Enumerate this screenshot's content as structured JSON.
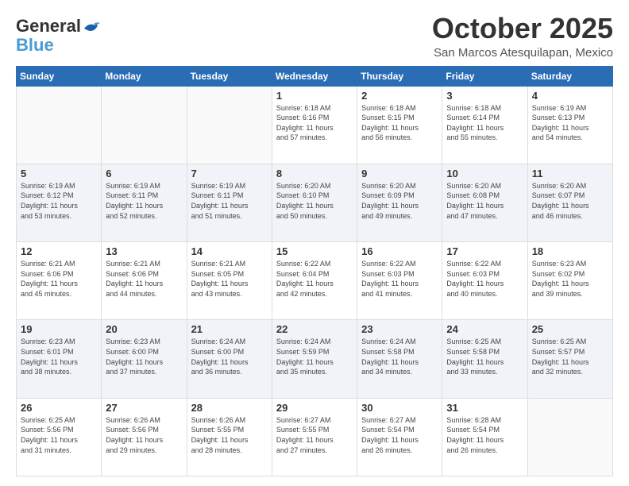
{
  "logo": {
    "general": "General",
    "blue": "Blue"
  },
  "header": {
    "month": "October 2025",
    "location": "San Marcos Atesquilapan, Mexico"
  },
  "weekdays": [
    "Sunday",
    "Monday",
    "Tuesday",
    "Wednesday",
    "Thursday",
    "Friday",
    "Saturday"
  ],
  "weeks": [
    {
      "shaded": false,
      "days": [
        {
          "date": "",
          "info": ""
        },
        {
          "date": "",
          "info": ""
        },
        {
          "date": "",
          "info": ""
        },
        {
          "date": "1",
          "info": "Sunrise: 6:18 AM\nSunset: 6:16 PM\nDaylight: 11 hours\nand 57 minutes."
        },
        {
          "date": "2",
          "info": "Sunrise: 6:18 AM\nSunset: 6:15 PM\nDaylight: 11 hours\nand 56 minutes."
        },
        {
          "date": "3",
          "info": "Sunrise: 6:18 AM\nSunset: 6:14 PM\nDaylight: 11 hours\nand 55 minutes."
        },
        {
          "date": "4",
          "info": "Sunrise: 6:19 AM\nSunset: 6:13 PM\nDaylight: 11 hours\nand 54 minutes."
        }
      ]
    },
    {
      "shaded": true,
      "days": [
        {
          "date": "5",
          "info": "Sunrise: 6:19 AM\nSunset: 6:12 PM\nDaylight: 11 hours\nand 53 minutes."
        },
        {
          "date": "6",
          "info": "Sunrise: 6:19 AM\nSunset: 6:11 PM\nDaylight: 11 hours\nand 52 minutes."
        },
        {
          "date": "7",
          "info": "Sunrise: 6:19 AM\nSunset: 6:11 PM\nDaylight: 11 hours\nand 51 minutes."
        },
        {
          "date": "8",
          "info": "Sunrise: 6:20 AM\nSunset: 6:10 PM\nDaylight: 11 hours\nand 50 minutes."
        },
        {
          "date": "9",
          "info": "Sunrise: 6:20 AM\nSunset: 6:09 PM\nDaylight: 11 hours\nand 49 minutes."
        },
        {
          "date": "10",
          "info": "Sunrise: 6:20 AM\nSunset: 6:08 PM\nDaylight: 11 hours\nand 47 minutes."
        },
        {
          "date": "11",
          "info": "Sunrise: 6:20 AM\nSunset: 6:07 PM\nDaylight: 11 hours\nand 46 minutes."
        }
      ]
    },
    {
      "shaded": false,
      "days": [
        {
          "date": "12",
          "info": "Sunrise: 6:21 AM\nSunset: 6:06 PM\nDaylight: 11 hours\nand 45 minutes."
        },
        {
          "date": "13",
          "info": "Sunrise: 6:21 AM\nSunset: 6:06 PM\nDaylight: 11 hours\nand 44 minutes."
        },
        {
          "date": "14",
          "info": "Sunrise: 6:21 AM\nSunset: 6:05 PM\nDaylight: 11 hours\nand 43 minutes."
        },
        {
          "date": "15",
          "info": "Sunrise: 6:22 AM\nSunset: 6:04 PM\nDaylight: 11 hours\nand 42 minutes."
        },
        {
          "date": "16",
          "info": "Sunrise: 6:22 AM\nSunset: 6:03 PM\nDaylight: 11 hours\nand 41 minutes."
        },
        {
          "date": "17",
          "info": "Sunrise: 6:22 AM\nSunset: 6:03 PM\nDaylight: 11 hours\nand 40 minutes."
        },
        {
          "date": "18",
          "info": "Sunrise: 6:23 AM\nSunset: 6:02 PM\nDaylight: 11 hours\nand 39 minutes."
        }
      ]
    },
    {
      "shaded": true,
      "days": [
        {
          "date": "19",
          "info": "Sunrise: 6:23 AM\nSunset: 6:01 PM\nDaylight: 11 hours\nand 38 minutes."
        },
        {
          "date": "20",
          "info": "Sunrise: 6:23 AM\nSunset: 6:00 PM\nDaylight: 11 hours\nand 37 minutes."
        },
        {
          "date": "21",
          "info": "Sunrise: 6:24 AM\nSunset: 6:00 PM\nDaylight: 11 hours\nand 36 minutes."
        },
        {
          "date": "22",
          "info": "Sunrise: 6:24 AM\nSunset: 5:59 PM\nDaylight: 11 hours\nand 35 minutes."
        },
        {
          "date": "23",
          "info": "Sunrise: 6:24 AM\nSunset: 5:58 PM\nDaylight: 11 hours\nand 34 minutes."
        },
        {
          "date": "24",
          "info": "Sunrise: 6:25 AM\nSunset: 5:58 PM\nDaylight: 11 hours\nand 33 minutes."
        },
        {
          "date": "25",
          "info": "Sunrise: 6:25 AM\nSunset: 5:57 PM\nDaylight: 11 hours\nand 32 minutes."
        }
      ]
    },
    {
      "shaded": false,
      "days": [
        {
          "date": "26",
          "info": "Sunrise: 6:25 AM\nSunset: 5:56 PM\nDaylight: 11 hours\nand 31 minutes."
        },
        {
          "date": "27",
          "info": "Sunrise: 6:26 AM\nSunset: 5:56 PM\nDaylight: 11 hours\nand 29 minutes."
        },
        {
          "date": "28",
          "info": "Sunrise: 6:26 AM\nSunset: 5:55 PM\nDaylight: 11 hours\nand 28 minutes."
        },
        {
          "date": "29",
          "info": "Sunrise: 6:27 AM\nSunset: 5:55 PM\nDaylight: 11 hours\nand 27 minutes."
        },
        {
          "date": "30",
          "info": "Sunrise: 6:27 AM\nSunset: 5:54 PM\nDaylight: 11 hours\nand 26 minutes."
        },
        {
          "date": "31",
          "info": "Sunrise: 6:28 AM\nSunset: 5:54 PM\nDaylight: 11 hours\nand 26 minutes."
        },
        {
          "date": "",
          "info": ""
        }
      ]
    }
  ]
}
